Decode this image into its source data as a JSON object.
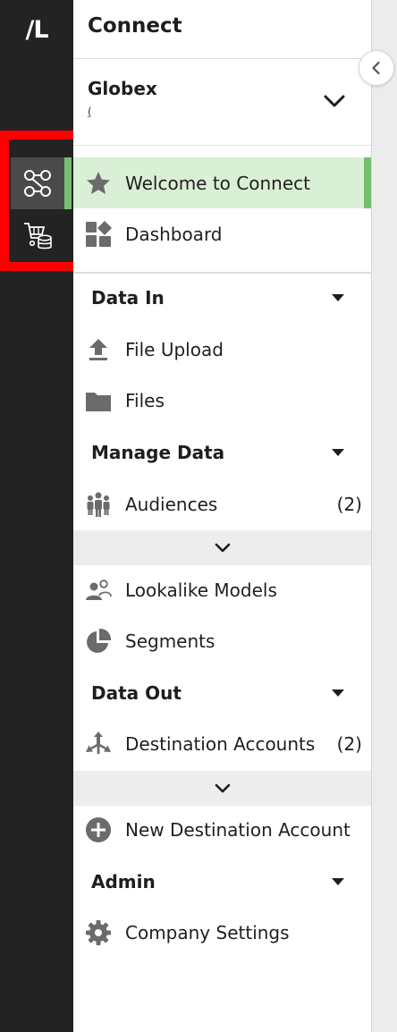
{
  "rail": {
    "logo": "/L",
    "items": [
      {
        "icon": "workflow-icon",
        "active": true
      },
      {
        "icon": "cart-database-icon",
        "active": false
      }
    ]
  },
  "header": {
    "title": "Connect"
  },
  "org": {
    "name": "Globex",
    "sub": "("
  },
  "nav": {
    "welcome": "Welcome to Connect",
    "dashboard": "Dashboard",
    "data_in": {
      "title": "Data In",
      "file_upload": "File Upload",
      "files": "Files"
    },
    "manage_data": {
      "title": "Manage Data",
      "audiences": "Audiences",
      "audiences_count": "(2)",
      "lookalike_models": "Lookalike Models",
      "segments": "Segments"
    },
    "data_out": {
      "title": "Data Out",
      "destination_accounts": "Destination Accounts",
      "destination_accounts_count": "(2)",
      "new_destination_account": "New Destination Account"
    },
    "admin": {
      "title": "Admin",
      "company_settings": "Company Settings"
    }
  },
  "colors": {
    "rail_bg": "#232323",
    "accent_green": "#74bf6d",
    "selected_bg": "#daf0d6",
    "highlight_red": "#ff0000",
    "icon_gray": "#6b6b6b"
  }
}
